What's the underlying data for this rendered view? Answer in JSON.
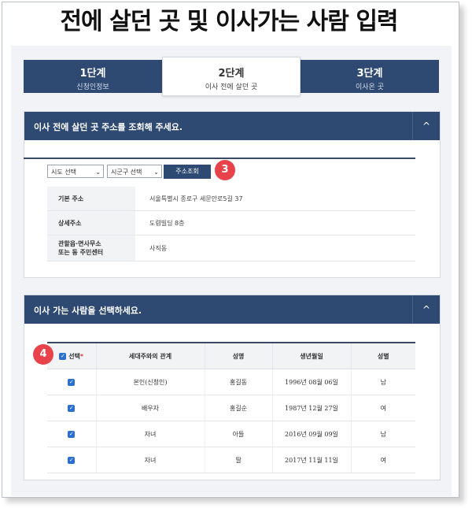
{
  "page": {
    "title": "전에 살던 곳 및 이사가는 사람 입력"
  },
  "steps": [
    {
      "num": "1단계",
      "label": "신청인정보",
      "active": false
    },
    {
      "num": "2단계",
      "label": "이사 전에 살던 곳",
      "active": true
    },
    {
      "num": "3단계",
      "label": "이사온 곳",
      "active": false
    }
  ],
  "address_section": {
    "title": "이사 전에 살던 곳 주소를 조회해 주세요.",
    "toggle_icon": "^",
    "sido_select": "시도 선택",
    "sigungu_select": "시군구 선택",
    "search_button": "주소조회",
    "badge": "3",
    "rows": [
      {
        "key": "기본 주소",
        "value": "서울특별시 종로구 세문안로5길 37"
      },
      {
        "key": "상세주소",
        "value": "도렴빌딩 8층"
      },
      {
        "key": "관할읍 면사무소 또는 동 주민센터",
        "key_line1": "관할읍·면사무소",
        "key_line2": "또는 동 주민센터",
        "value": "사직동"
      }
    ]
  },
  "people_section": {
    "title": "이사 가는 사람을 선택하세요.",
    "toggle_icon": "^",
    "badge": "4",
    "headers": {
      "select": "선택",
      "required": "*",
      "relation": "세대주와의 관계",
      "name": "성명",
      "birth": "생년월일",
      "gender": "성별"
    },
    "rows": [
      {
        "checked": true,
        "relation": "본인(신청인)",
        "name": "홍길동",
        "birth": "1996년 08월 06일",
        "gender": "남"
      },
      {
        "checked": true,
        "relation": "배우자",
        "name": "홍길순",
        "birth": "1987년 12월 27일",
        "gender": "여"
      },
      {
        "checked": true,
        "relation": "자녀",
        "name": "아들",
        "birth": "2016년 09월 09일",
        "gender": "남"
      },
      {
        "checked": true,
        "relation": "자녀",
        "name": "딸",
        "birth": "2017년 11월 11일",
        "gender": "여"
      }
    ]
  },
  "colors": {
    "navy": "#2f4a72",
    "badge": "#e8424b",
    "checkbox": "#2b6fd0"
  }
}
